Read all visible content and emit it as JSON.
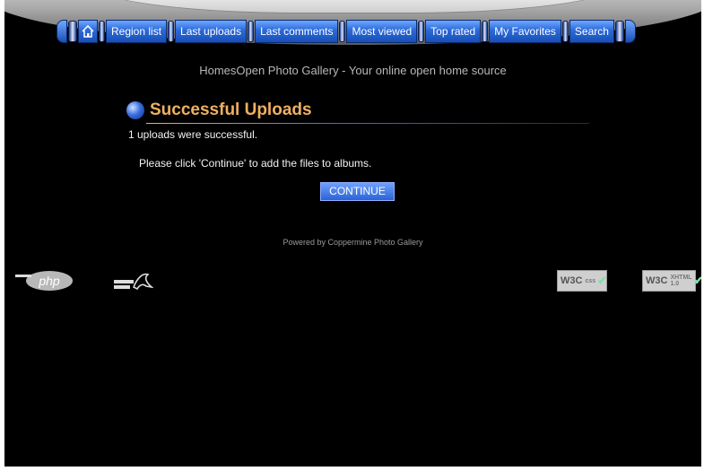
{
  "nav": {
    "items": [
      "Region list",
      "Last uploads",
      "Last comments",
      "Most viewed",
      "Top rated",
      "My Favorites",
      "Search"
    ]
  },
  "tagline": "HomesOpen Photo Gallery - Your online open home source",
  "heading": "Successful Uploads",
  "messages": {
    "success": "1 uploads were successful.",
    "instruction": "Please click 'Continue' to add the files to albums."
  },
  "continue_label": "CONTINUE",
  "footer": {
    "powered_by": "Powered by Coppermine Photo Gallery",
    "badges": {
      "php": "php",
      "css": "W3C",
      "css_sub": "css",
      "xhtml": "W3C",
      "xhtml_sub": "XHTML 1.0"
    }
  },
  "icons": [
    "home-icon",
    "orb-icon",
    "php-logo",
    "mysql-logo",
    "w3c-css-badge",
    "w3c-xhtml-badge"
  ],
  "colors": {
    "background": "#000000",
    "accent": "#2a69d9",
    "heading": "#f0b060"
  }
}
